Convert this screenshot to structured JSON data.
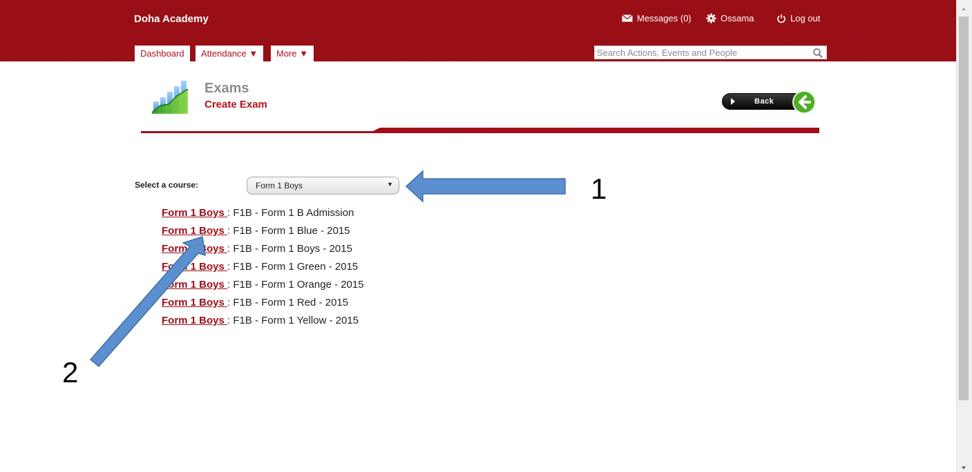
{
  "header": {
    "app_title": "Doha Academy",
    "messages_label": "Messages (0)",
    "user_label": "Ossama",
    "logout_label": "Log out",
    "search_placeholder": "Search Actions, Events and People"
  },
  "nav": {
    "tabs": [
      {
        "label": "Dashboard"
      },
      {
        "label": "Attendance ▼"
      },
      {
        "label": "More ▼"
      }
    ]
  },
  "page": {
    "title": "Exams",
    "subtitle": "Create Exam",
    "back_label": "Back"
  },
  "course_selector": {
    "label": "Select a course:",
    "selected": "Form 1 Boys",
    "caret": "▼"
  },
  "courses": [
    {
      "link": "Form 1 Boys ",
      "desc": "F1B - Form 1 B Admission"
    },
    {
      "link": "Form 1 Boys ",
      "desc": "F1B - Form 1 Blue - 2015"
    },
    {
      "link": "Form 1 Boys ",
      "desc": "F1B - Form 1 Boys - 2015"
    },
    {
      "link": "Form 1 Boys ",
      "desc": "F1B - Form 1 Green - 2015"
    },
    {
      "link": "Form 1 Boys ",
      "desc": "F1B - Form 1 Orange - 2015"
    },
    {
      "link": "Form 1 Boys ",
      "desc": "F1B - Form 1 Red - 2015"
    },
    {
      "link": "Form 1 Boys ",
      "desc": "F1B - Form 1 Yellow - 2015"
    }
  ],
  "annotations": {
    "one": "1",
    "two": "2",
    "arrow_color": "#5b8fcf"
  },
  "colors": {
    "header_red": "#9d0f16",
    "accent_red": "#b5121b",
    "link_red": "#9b0d17"
  },
  "icons": [
    "envelope-icon",
    "gear-icon",
    "power-icon",
    "search-icon",
    "bar-chart-icon",
    "back-arrow-icon"
  ]
}
